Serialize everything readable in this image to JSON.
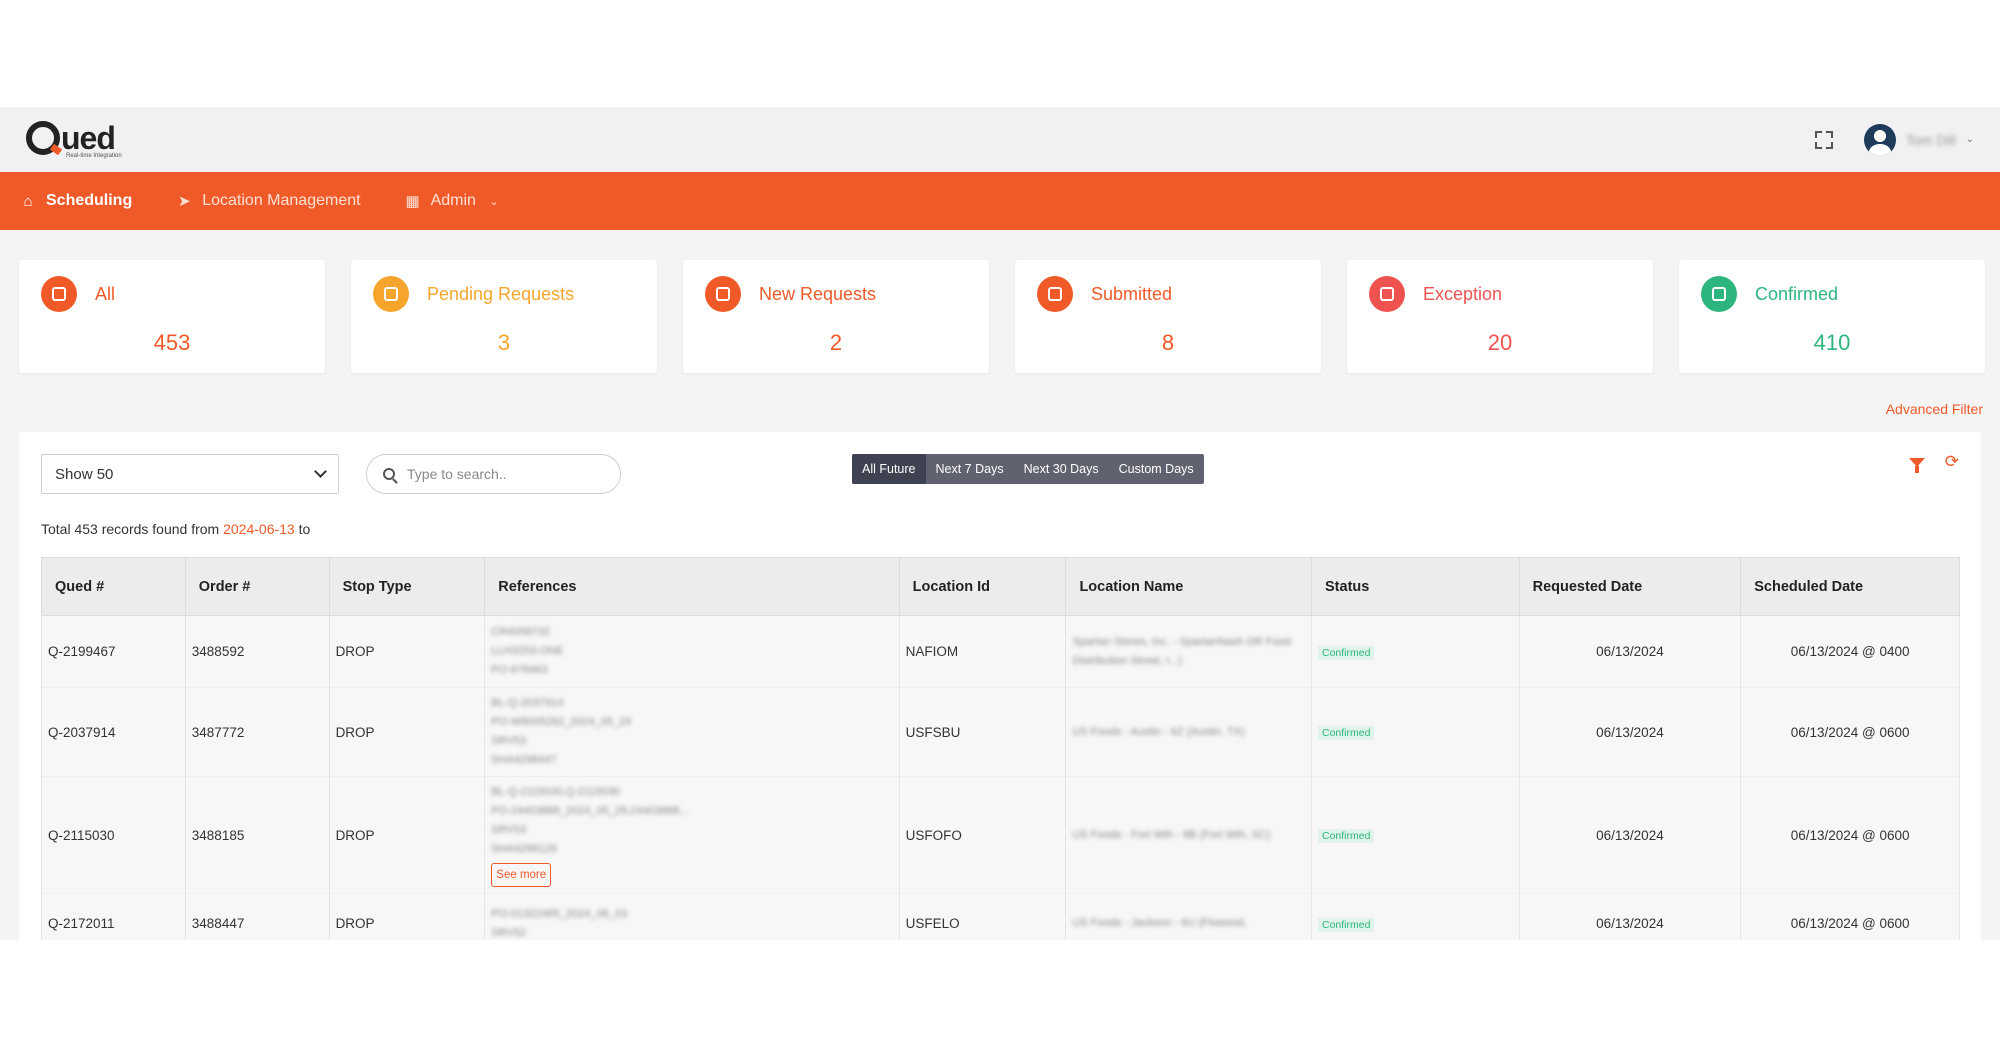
{
  "app": {
    "logo": "Qued",
    "logo_tagline": "Real-time Integration",
    "user_name": "Tom Dill"
  },
  "nav": [
    {
      "label": "Scheduling",
      "icon": "home-icon"
    },
    {
      "label": "Location Management",
      "icon": "send-icon"
    },
    {
      "label": "Admin",
      "icon": "grid-icon"
    }
  ],
  "cards": [
    {
      "title": "All",
      "count": "453",
      "color": "#f05a28",
      "icon": "copy-icon"
    },
    {
      "title": "Pending Requests",
      "count": "3",
      "color": "#f5a52c",
      "icon": "calendar-check-icon"
    },
    {
      "title": "New Requests",
      "count": "2",
      "color": "#f05a28",
      "icon": "calendar-check-icon"
    },
    {
      "title": "Submitted",
      "count": "8",
      "color": "#f05a28",
      "icon": "hourglass-icon"
    },
    {
      "title": "Exception",
      "count": "20",
      "color": "#ef5350",
      "icon": "calendar-x-icon"
    },
    {
      "title": "Confirmed",
      "count": "410",
      "color": "#2cb67d",
      "icon": "calendar-check-icon"
    }
  ],
  "advanced_filter": "Advanced Filter",
  "controls": {
    "page_size": "Show 50",
    "search_placeholder": "Type to search..",
    "ranges": [
      "All Future",
      "Next 7 Days",
      "Next 30 Days",
      "Custom Days"
    ],
    "active_range": "All Future"
  },
  "records": {
    "prefix": "Total 453 records found from",
    "date": "2024-06-13",
    "suffix": "to"
  },
  "table": {
    "headers": [
      "Qued #",
      "Order #",
      "Stop Type",
      "References",
      "Location Id",
      "Location Name",
      "Status",
      "Requested Date",
      "Scheduled Date"
    ],
    "rows": [
      {
        "qued": "Q-2199467",
        "order": "3488592",
        "stop": "DROP",
        "refs": [
          "CR4058732",
          "LLH3253-ONE",
          "PO-678463"
        ],
        "loc_id": "NAFIOM",
        "loc_name": "Spartan Stores, Inc. - SpartanNash DR Food Distribution Street, I...)",
        "status": "Confirmed",
        "requested": "06/13/2024",
        "scheduled": "06/13/2024 @ 0400",
        "see_more": ""
      },
      {
        "qued": "Q-2037914",
        "order": "3487772",
        "stop": "DROP",
        "refs": [
          "BL-Q-2037914",
          "PO-W8005282_2024_05_24",
          "SRV53",
          "SHA4298447"
        ],
        "loc_id": "USFSBU",
        "loc_name": "US Foods - Austin - 6Z (Austin, TX)",
        "status": "Confirmed",
        "requested": "06/13/2024",
        "scheduled": "06/13/2024 @ 0600",
        "see_more": ""
      },
      {
        "qued": "Q-2115030",
        "order": "3488185",
        "stop": "DROP",
        "refs": [
          "BL-Q-2115030,Q-2115030",
          "PO-24403888_2024_05_29,24403888...",
          "SRV53",
          "SHA4298129"
        ],
        "loc_id": "USFOFO",
        "loc_name": "US Foods - Fort Wth - 8B (Fort Wth, SC)",
        "status": "Confirmed",
        "requested": "06/13/2024",
        "scheduled": "06/13/2024 @ 0600",
        "see_more": "See more"
      },
      {
        "qued": "Q-2172011",
        "order": "3488447",
        "stop": "DROP",
        "refs": [
          "PO-01322465_2024_06_03",
          "SRV52"
        ],
        "loc_id": "USFELO",
        "loc_name": "US Foods - Jackson - 6U (Flowood,",
        "status": "Confirmed",
        "requested": "06/13/2024",
        "scheduled": "06/13/2024 @ 0600",
        "see_more": ""
      }
    ]
  }
}
